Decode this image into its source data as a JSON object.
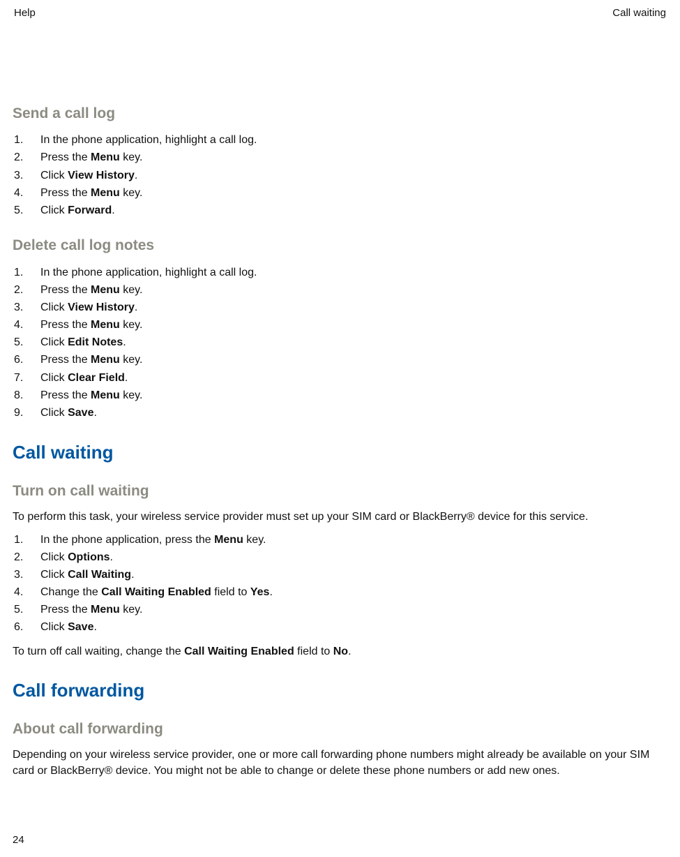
{
  "header": {
    "left": "Help",
    "right": "Call waiting"
  },
  "footer": {
    "page_number": "24"
  },
  "send_call_log": {
    "title": "Send a call log",
    "steps": {
      "s1": {
        "text": "In the phone application, highlight a call log."
      },
      "s2": {
        "pre": "Press the ",
        "bold": "Menu",
        "post": " key."
      },
      "s3": {
        "pre": "Click ",
        "bold": "View History",
        "post": "."
      },
      "s4": {
        "pre": "Press the ",
        "bold": "Menu",
        "post": " key."
      },
      "s5": {
        "pre": "Click ",
        "bold": "Forward",
        "post": "."
      }
    }
  },
  "delete_notes": {
    "title": "Delete call log notes",
    "steps": {
      "s1": {
        "text": "In the phone application, highlight a call log."
      },
      "s2": {
        "pre": "Press the ",
        "bold": "Menu",
        "post": " key."
      },
      "s3": {
        "pre": "Click ",
        "bold": "View History",
        "post": "."
      },
      "s4": {
        "pre": "Press the ",
        "bold": "Menu",
        "post": " key."
      },
      "s5": {
        "pre": "Click ",
        "bold": "Edit Notes",
        "post": "."
      },
      "s6": {
        "pre": "Press the ",
        "bold": "Menu",
        "post": " key."
      },
      "s7": {
        "pre": "Click ",
        "bold": "Clear Field",
        "post": "."
      },
      "s8": {
        "pre": "Press the ",
        "bold": "Menu",
        "post": " key."
      },
      "s9": {
        "pre": "Click ",
        "bold": "Save",
        "post": "."
      }
    }
  },
  "call_waiting": {
    "title": "Call waiting",
    "sub": {
      "title": "Turn on call waiting",
      "intro": "To perform this task, your wireless service provider must set up your SIM card or BlackBerry® device for this service.",
      "steps": {
        "s1": {
          "pre": "In the phone application, press the ",
          "bold": "Menu",
          "post": " key."
        },
        "s2": {
          "pre": "Click ",
          "bold": "Options",
          "post": "."
        },
        "s3": {
          "pre": "Click ",
          "bold": "Call Waiting",
          "post": "."
        },
        "s4": {
          "pre": "Change the ",
          "bold": "Call Waiting Enabled",
          "mid": " field to ",
          "bold2": "Yes",
          "post": "."
        },
        "s5": {
          "pre": "Press the ",
          "bold": "Menu",
          "post": " key."
        },
        "s6": {
          "pre": "Click ",
          "bold": "Save",
          "post": "."
        }
      },
      "outro": {
        "pre": "To turn off call waiting, change the ",
        "bold": "Call Waiting Enabled",
        "mid": " field to ",
        "bold2": "No",
        "post": "."
      }
    }
  },
  "call_forwarding": {
    "title": "Call forwarding",
    "sub": {
      "title": "About call forwarding",
      "paragraph": "Depending on your wireless service provider, one or more call forwarding phone numbers might already be available on your SIM card or BlackBerry® device. You might not be able to change or delete these phone numbers or add new ones."
    }
  }
}
